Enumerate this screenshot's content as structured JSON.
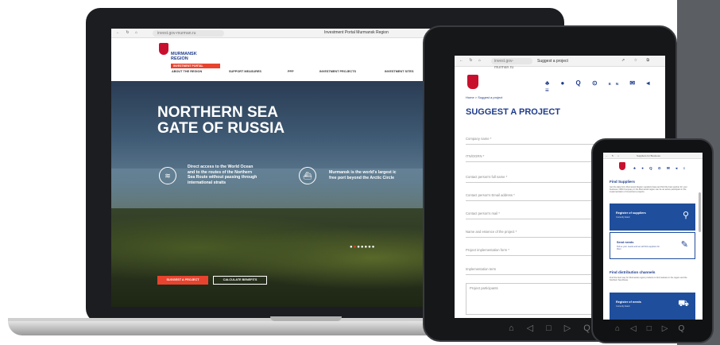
{
  "laptop": {
    "url": "invest.gov-murman.ru",
    "tab_title": "Investment Portal Murmansk Region",
    "brand_line1": "MURMANSK",
    "brand_line2": "REGION",
    "portal_tag": "INVESTMENT PORTAL",
    "menu": [
      "ABOUT THE REGION",
      "SUPPORT MEASURES",
      "PPP",
      "INVESTMENT PROJECTS",
      "INVESTMENT SITES"
    ],
    "hero_title_1": "NORTHERN SEA",
    "hero_title_2": "GATE OF RUSSIA",
    "feature1": [
      "Direct access to the World Ocean",
      "and to the routes of the Northern",
      "Sea Route without passing through",
      "international straits"
    ],
    "feature2": [
      "Murmansk is the world's largest ic",
      "free port beyond the Arctic Circle"
    ],
    "btn_suggest": "SUGGEST A PROJECT",
    "btn_calc": "CALCULATE BENEFITS"
  },
  "tablet": {
    "url": "invest.gov-murman.ru",
    "tab_title": "Suggest a project",
    "lang": "EN",
    "breadcrumb": "Home > Suggest a project",
    "title": "SUGGEST A PROJECT",
    "fields": [
      "Company name *",
      "ITN/OGRN *",
      "Contact person's full name *",
      "Contact person's Email address *",
      "Contact person's mail *",
      "Name and essence of the project *",
      "Project implementation form *",
      "Implementation term",
      "Project participants"
    ]
  },
  "phone": {
    "tab_title": "Suppliers for Business",
    "h1": "Find Suppliers",
    "p1": "Get the data from Murmansk Region suppliers base and find the best partner for your business. NSM Company in the Murmansk region can be an active participant in the implementation of investment projects.",
    "card1_title": "Register of suppliers",
    "card1_sub": "Currently listed",
    "card2_title": "Send needs",
    "card2_sub": "Tell us your needs and we will find suppliers for them",
    "h2": "Find distribution channels",
    "p2": "Find the best way for Murmansk region products to find markets in the region and the Northern Sea Route.",
    "card3_title": "Register of needs",
    "card3_sub": "Currently listed"
  }
}
